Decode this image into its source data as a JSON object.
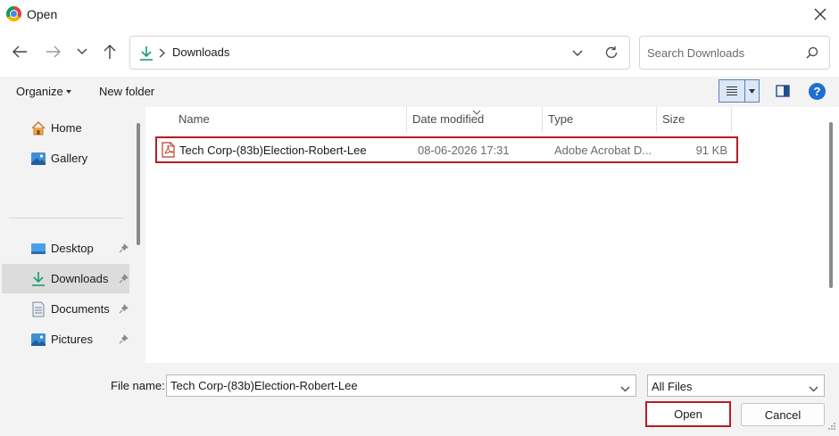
{
  "window": {
    "title": "Open",
    "app_icon": "chrome-icon",
    "close_icon": "close-icon"
  },
  "navigation": {
    "back_icon": "back-arrow-icon",
    "forward_icon": "forward-arrow-icon",
    "recent_icon": "chevron-down-icon",
    "up_icon": "up-arrow-icon",
    "address": {
      "location_icon": "download-icon",
      "path": "Downloads",
      "refresh_icon": "refresh-icon"
    },
    "search": {
      "placeholder": "Search Downloads",
      "value": "",
      "icon": "search-icon"
    }
  },
  "toolbar": {
    "organize_label": "Organize",
    "new_folder_label": "New folder",
    "view_icon": "details-view-icon",
    "preview_pane_icon": "preview-pane-icon",
    "help_label": "?"
  },
  "sidebar": {
    "items": [
      {
        "label": "Home",
        "icon": "home-icon",
        "pinned": false,
        "selected": false
      },
      {
        "label": "Gallery",
        "icon": "gallery-icon",
        "pinned": false,
        "selected": false
      },
      {
        "label": "Desktop",
        "icon": "desktop-icon",
        "pinned": true,
        "selected": false
      },
      {
        "label": "Downloads",
        "icon": "download-icon",
        "pinned": true,
        "selected": true
      },
      {
        "label": "Documents",
        "icon": "documents-icon",
        "pinned": true,
        "selected": false
      },
      {
        "label": "Pictures",
        "icon": "pictures-icon",
        "pinned": true,
        "selected": false
      }
    ]
  },
  "file_list": {
    "columns": [
      "Name",
      "Date modified",
      "Type",
      "Size"
    ],
    "sort_column": "Date modified",
    "rows": [
      {
        "name": "Tech Corp-(83b)Election-Robert-Lee",
        "date_modified": "08-06-2026 17:31",
        "type": "Adobe Acrobat D...",
        "size": "91 KB",
        "icon": "pdf-file-icon"
      }
    ]
  },
  "footer": {
    "file_name_label": "File name:",
    "file_name_value": "Tech Corp-(83b)Election-Robert-Lee",
    "file_type_value": "All Files",
    "open_label": "Open",
    "cancel_label": "Cancel"
  },
  "colors": {
    "highlight_border": "#b71c24",
    "accent": "#1f6fd1",
    "selected_bg": "#dcdcdc",
    "download_green": "#1a9e6e"
  }
}
